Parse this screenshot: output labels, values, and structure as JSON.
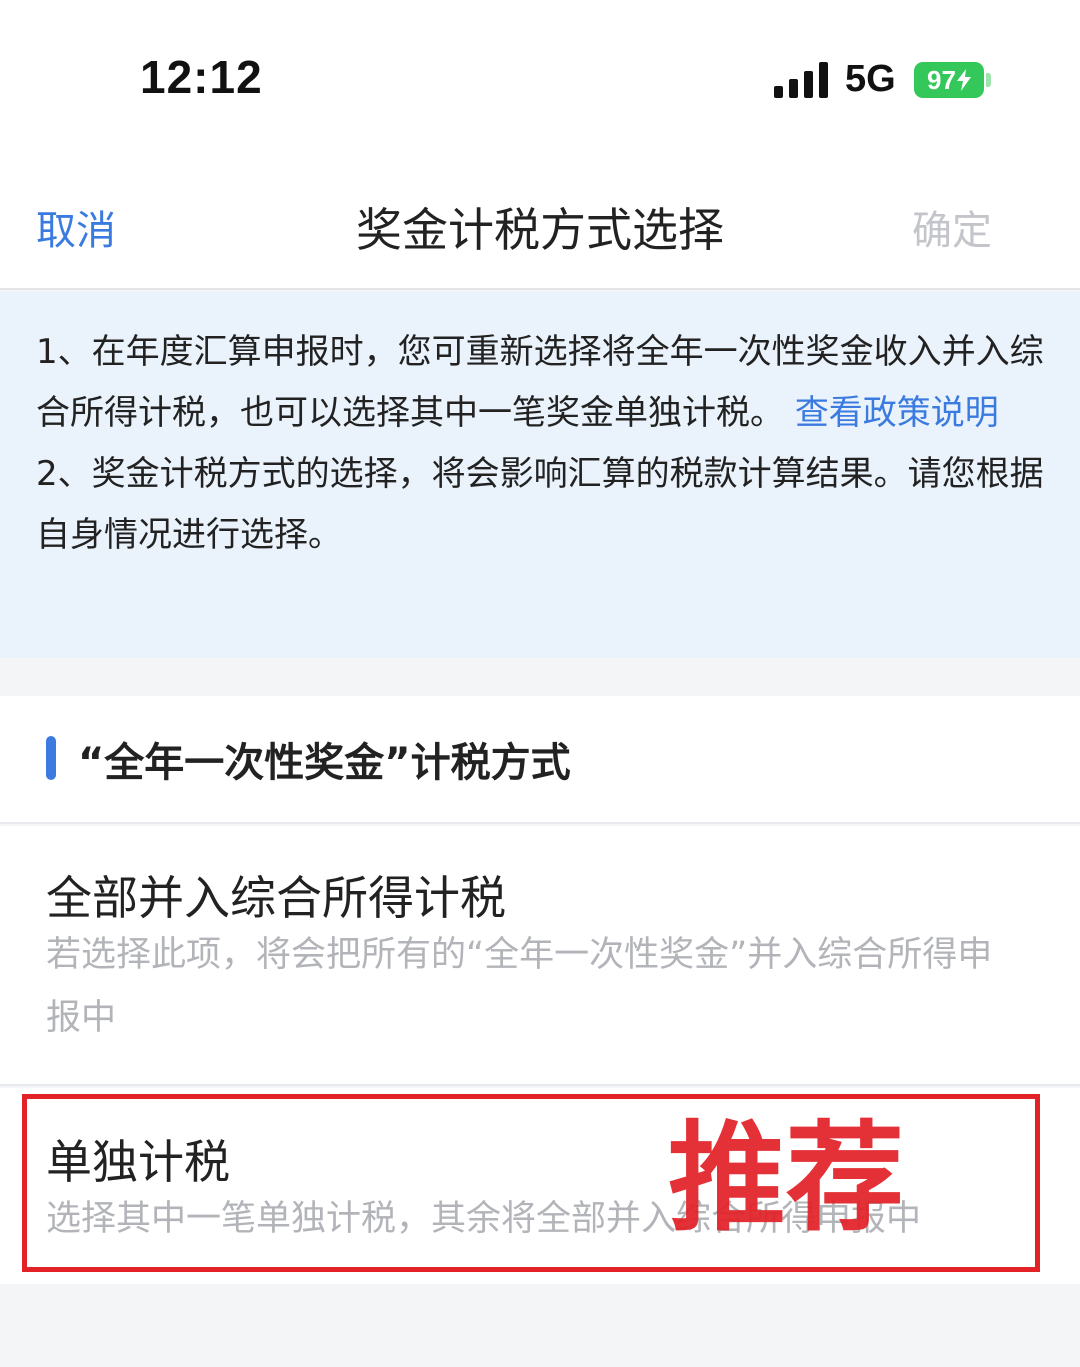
{
  "status_bar": {
    "time": "12:12",
    "network": "5G",
    "battery": "97"
  },
  "nav": {
    "cancel": "取消",
    "title": "奖金计税方式选择",
    "confirm": "确定"
  },
  "info": {
    "para1_text": "1、在年度汇算申报时，您可重新选择将全年一次性奖金收入并入综合所得计税，也可以选择其中一笔奖金单独计税。",
    "para1_link": "查看政策说明",
    "para2_text": "2、奖金计税方式的选择，将会影响汇算的税款计算结果。请您根据自身情况进行选择。"
  },
  "section": {
    "title": "“全年一次性奖金”计税方式"
  },
  "options": [
    {
      "title": "全部并入综合所得计税",
      "description": "若选择此项，将会把所有的“全年一次性奖金”并入综合所得申报中"
    },
    {
      "title": "单独计税",
      "description": "选择其中一笔单独计税，其余将全部并入综合所得申报中"
    }
  ],
  "annotation": {
    "label": "推荐",
    "color": "#e32228"
  },
  "colors": {
    "accent": "#3b7be0",
    "info_bg": "#eaf2fb",
    "battery": "#34c759",
    "muted_text": "#b2b4b9"
  }
}
